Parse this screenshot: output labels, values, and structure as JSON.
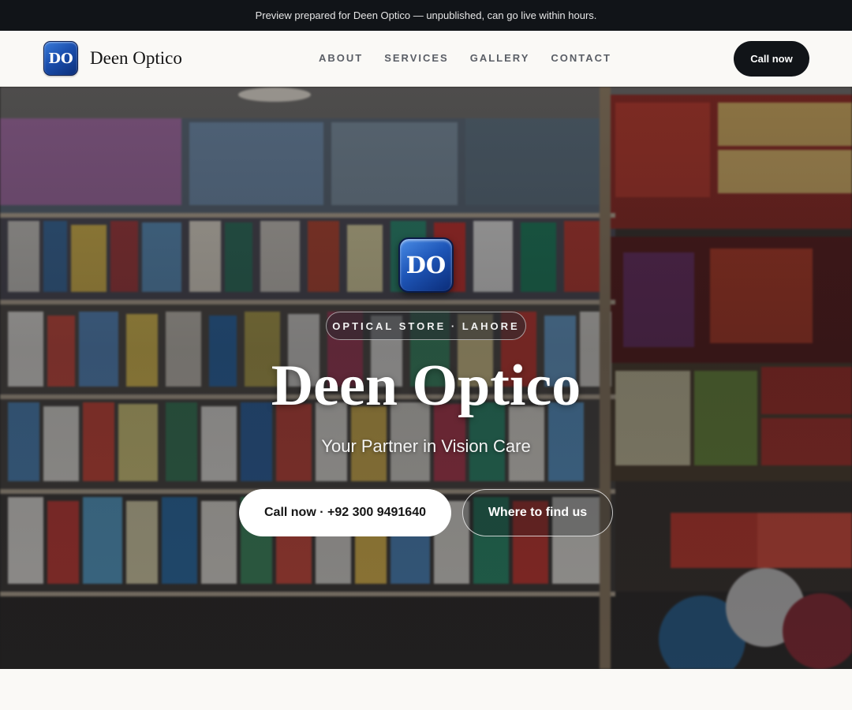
{
  "banner": {
    "text": "Preview prepared for Deen Optico — unpublished, can go live within hours."
  },
  "header": {
    "logo_initials": "DO",
    "brand_name": "Deen Optico",
    "nav": [
      "ABOUT",
      "SERVICES",
      "GALLERY",
      "CONTACT"
    ],
    "call_label": "Call now"
  },
  "hero": {
    "background_icon": "store-shelves-photo",
    "logo_initials": "DO",
    "tagline": "OPTICAL STORE · LAHORE",
    "title": "Deen Optico",
    "subtitle": "Your Partner in Vision Care",
    "primary_cta": "Call now · +92 300 9491640",
    "secondary_cta": "Where to find us"
  },
  "colors": {
    "banner_bg": "#111418",
    "page_bg": "#faf9f6",
    "dark_button": "#111418",
    "logo_blue": "#1b4fae",
    "nav_text": "#5a5e66"
  }
}
